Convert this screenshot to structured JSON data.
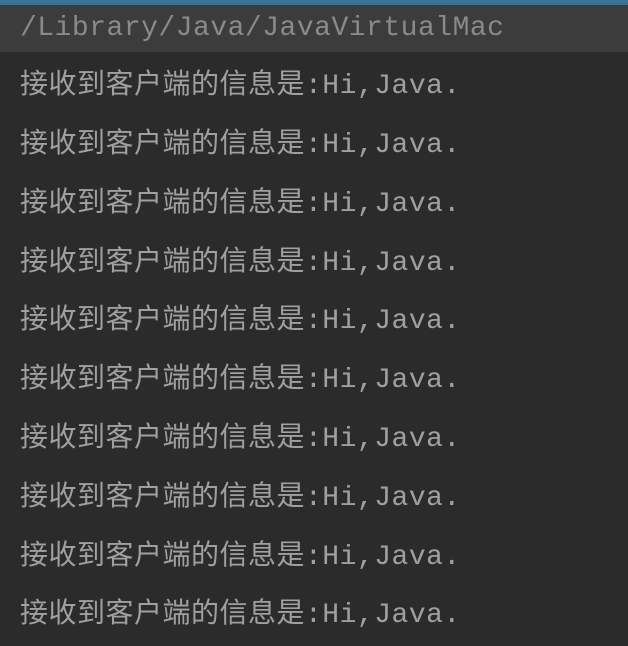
{
  "header": {
    "path": "/Library/Java/JavaVirtualMac"
  },
  "console": {
    "lines": [
      "接收到客户端的信息是:Hi,Java.",
      "接收到客户端的信息是:Hi,Java.",
      "接收到客户端的信息是:Hi,Java.",
      "接收到客户端的信息是:Hi,Java.",
      "接收到客户端的信息是:Hi,Java.",
      "接收到客户端的信息是:Hi,Java.",
      "接收到客户端的信息是:Hi,Java.",
      "接收到客户端的信息是:Hi,Java.",
      "接收到客户端的信息是:Hi,Java.",
      "接收到客户端的信息是:Hi,Java."
    ]
  }
}
